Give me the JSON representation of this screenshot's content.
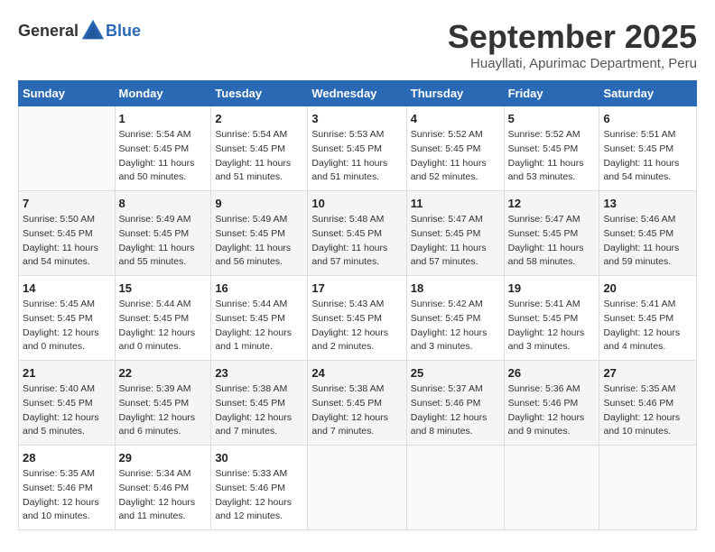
{
  "header": {
    "logo_general": "General",
    "logo_blue": "Blue",
    "month_title": "September 2025",
    "subtitle": "Huayllati, Apurimac Department, Peru"
  },
  "calendar": {
    "weekdays": [
      "Sunday",
      "Monday",
      "Tuesday",
      "Wednesday",
      "Thursday",
      "Friday",
      "Saturday"
    ],
    "weeks": [
      [
        {
          "day": "",
          "info": ""
        },
        {
          "day": "1",
          "info": "Sunrise: 5:54 AM\nSunset: 5:45 PM\nDaylight: 11 hours\nand 50 minutes."
        },
        {
          "day": "2",
          "info": "Sunrise: 5:54 AM\nSunset: 5:45 PM\nDaylight: 11 hours\nand 51 minutes."
        },
        {
          "day": "3",
          "info": "Sunrise: 5:53 AM\nSunset: 5:45 PM\nDaylight: 11 hours\nand 51 minutes."
        },
        {
          "day": "4",
          "info": "Sunrise: 5:52 AM\nSunset: 5:45 PM\nDaylight: 11 hours\nand 52 minutes."
        },
        {
          "day": "5",
          "info": "Sunrise: 5:52 AM\nSunset: 5:45 PM\nDaylight: 11 hours\nand 53 minutes."
        },
        {
          "day": "6",
          "info": "Sunrise: 5:51 AM\nSunset: 5:45 PM\nDaylight: 11 hours\nand 54 minutes."
        }
      ],
      [
        {
          "day": "7",
          "info": "Sunrise: 5:50 AM\nSunset: 5:45 PM\nDaylight: 11 hours\nand 54 minutes."
        },
        {
          "day": "8",
          "info": "Sunrise: 5:49 AM\nSunset: 5:45 PM\nDaylight: 11 hours\nand 55 minutes."
        },
        {
          "day": "9",
          "info": "Sunrise: 5:49 AM\nSunset: 5:45 PM\nDaylight: 11 hours\nand 56 minutes."
        },
        {
          "day": "10",
          "info": "Sunrise: 5:48 AM\nSunset: 5:45 PM\nDaylight: 11 hours\nand 57 minutes."
        },
        {
          "day": "11",
          "info": "Sunrise: 5:47 AM\nSunset: 5:45 PM\nDaylight: 11 hours\nand 57 minutes."
        },
        {
          "day": "12",
          "info": "Sunrise: 5:47 AM\nSunset: 5:45 PM\nDaylight: 11 hours\nand 58 minutes."
        },
        {
          "day": "13",
          "info": "Sunrise: 5:46 AM\nSunset: 5:45 PM\nDaylight: 11 hours\nand 59 minutes."
        }
      ],
      [
        {
          "day": "14",
          "info": "Sunrise: 5:45 AM\nSunset: 5:45 PM\nDaylight: 12 hours\nand 0 minutes."
        },
        {
          "day": "15",
          "info": "Sunrise: 5:44 AM\nSunset: 5:45 PM\nDaylight: 12 hours\nand 0 minutes."
        },
        {
          "day": "16",
          "info": "Sunrise: 5:44 AM\nSunset: 5:45 PM\nDaylight: 12 hours\nand 1 minute."
        },
        {
          "day": "17",
          "info": "Sunrise: 5:43 AM\nSunset: 5:45 PM\nDaylight: 12 hours\nand 2 minutes."
        },
        {
          "day": "18",
          "info": "Sunrise: 5:42 AM\nSunset: 5:45 PM\nDaylight: 12 hours\nand 3 minutes."
        },
        {
          "day": "19",
          "info": "Sunrise: 5:41 AM\nSunset: 5:45 PM\nDaylight: 12 hours\nand 3 minutes."
        },
        {
          "day": "20",
          "info": "Sunrise: 5:41 AM\nSunset: 5:45 PM\nDaylight: 12 hours\nand 4 minutes."
        }
      ],
      [
        {
          "day": "21",
          "info": "Sunrise: 5:40 AM\nSunset: 5:45 PM\nDaylight: 12 hours\nand 5 minutes."
        },
        {
          "day": "22",
          "info": "Sunrise: 5:39 AM\nSunset: 5:45 PM\nDaylight: 12 hours\nand 6 minutes."
        },
        {
          "day": "23",
          "info": "Sunrise: 5:38 AM\nSunset: 5:45 PM\nDaylight: 12 hours\nand 7 minutes."
        },
        {
          "day": "24",
          "info": "Sunrise: 5:38 AM\nSunset: 5:45 PM\nDaylight: 12 hours\nand 7 minutes."
        },
        {
          "day": "25",
          "info": "Sunrise: 5:37 AM\nSunset: 5:46 PM\nDaylight: 12 hours\nand 8 minutes."
        },
        {
          "day": "26",
          "info": "Sunrise: 5:36 AM\nSunset: 5:46 PM\nDaylight: 12 hours\nand 9 minutes."
        },
        {
          "day": "27",
          "info": "Sunrise: 5:35 AM\nSunset: 5:46 PM\nDaylight: 12 hours\nand 10 minutes."
        }
      ],
      [
        {
          "day": "28",
          "info": "Sunrise: 5:35 AM\nSunset: 5:46 PM\nDaylight: 12 hours\nand 10 minutes."
        },
        {
          "day": "29",
          "info": "Sunrise: 5:34 AM\nSunset: 5:46 PM\nDaylight: 12 hours\nand 11 minutes."
        },
        {
          "day": "30",
          "info": "Sunrise: 5:33 AM\nSunset: 5:46 PM\nDaylight: 12 hours\nand 12 minutes."
        },
        {
          "day": "",
          "info": ""
        },
        {
          "day": "",
          "info": ""
        },
        {
          "day": "",
          "info": ""
        },
        {
          "day": "",
          "info": ""
        }
      ]
    ]
  }
}
